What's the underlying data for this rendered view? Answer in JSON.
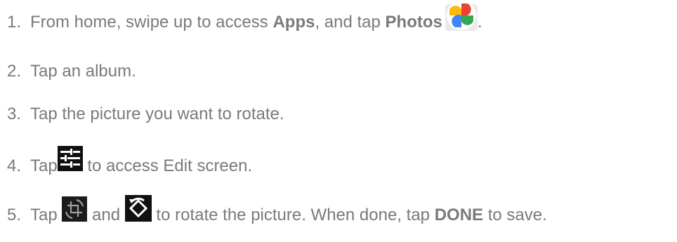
{
  "steps": [
    {
      "number": "1.",
      "text_a": "From home, swipe up to access ",
      "bold_a": "Apps",
      "text_b": ", and tap ",
      "bold_b": "Photos",
      "text_c": ".",
      "icon": "google-photos-pinwheel-icon"
    },
    {
      "number": "2.",
      "text": "Tap an album."
    },
    {
      "number": "3.",
      "text": "Tap the picture you want to rotate."
    },
    {
      "number": "4.",
      "text_a": "Tap",
      "text_b": " to access Edit screen.",
      "icon": "edit-sliders-icon"
    },
    {
      "number": "5.",
      "text_a": "Tap ",
      "text_b": " and ",
      "text_c": " to rotate the picture. When done, tap ",
      "bold_a": "DONE",
      "text_d": " to save.",
      "icons": [
        "crop-rotate-icon",
        "rotate-icon"
      ]
    }
  ],
  "colors": {
    "text": "#7a7a7a",
    "icon_dark": "#111111",
    "photos_red": "#ea4335",
    "photos_yellow": "#fbbc05",
    "photos_green": "#34a853",
    "photos_blue": "#4285f4"
  }
}
